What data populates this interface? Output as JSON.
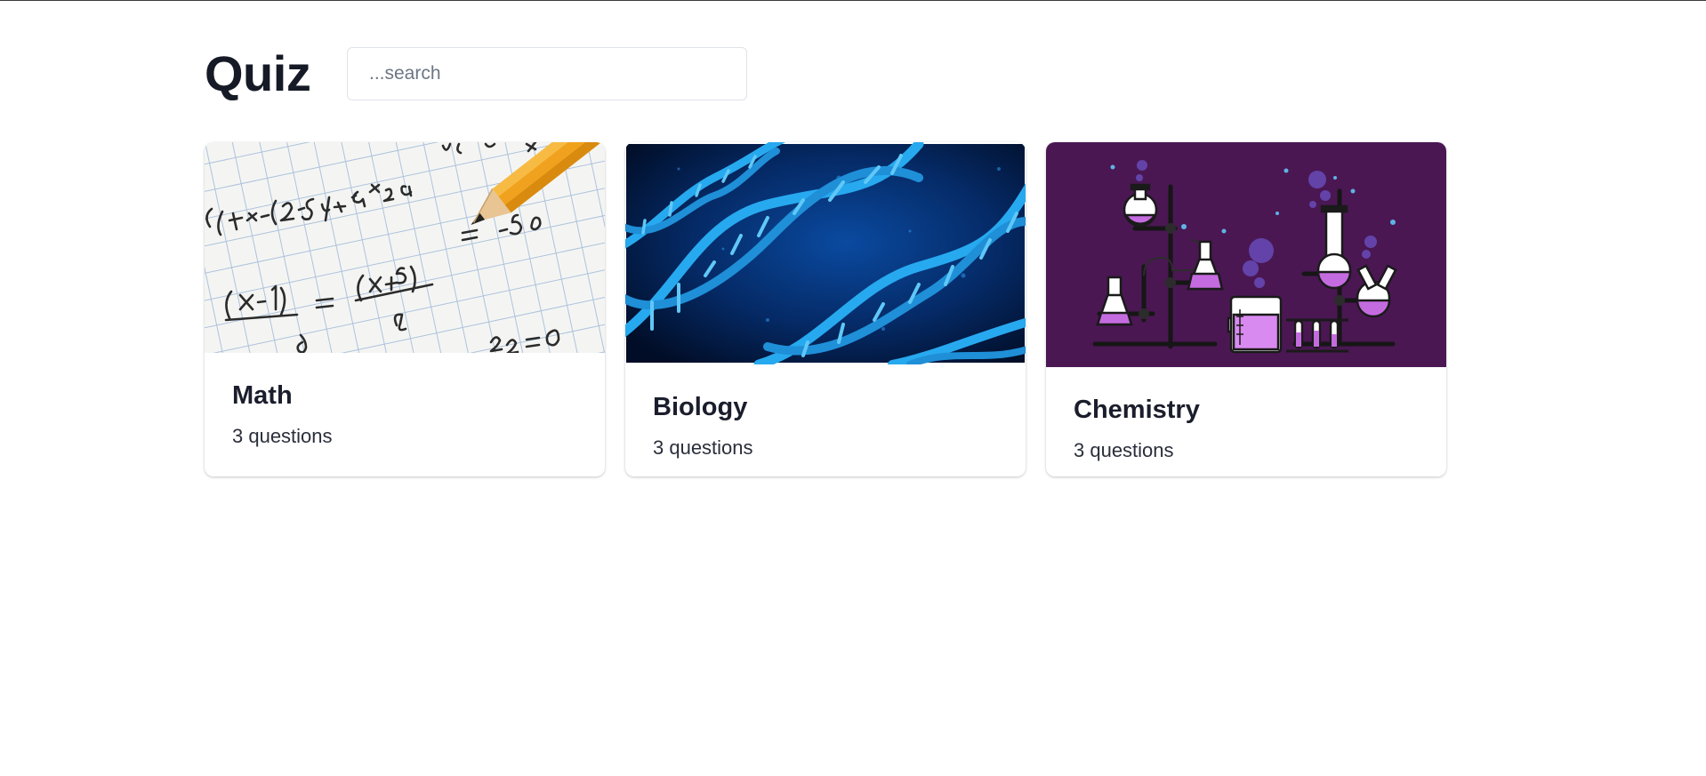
{
  "header": {
    "title": "Quiz",
    "search_placeholder": "...search"
  },
  "quizzes": [
    {
      "title": "Math",
      "count_label": "3 questions",
      "image": "math-worksheet-pencil-image"
    },
    {
      "title": "Biology",
      "count_label": "3 questions",
      "image": "dna-helix-image"
    },
    {
      "title": "Chemistry",
      "count_label": "3 questions",
      "image": "chemistry-lab-flasks-image"
    }
  ],
  "colors": {
    "chemistry_bg": "#4a1753",
    "biology_bg": "#021a44",
    "helix": "#2ab3ef",
    "text_dark": "#1a1e2c"
  }
}
